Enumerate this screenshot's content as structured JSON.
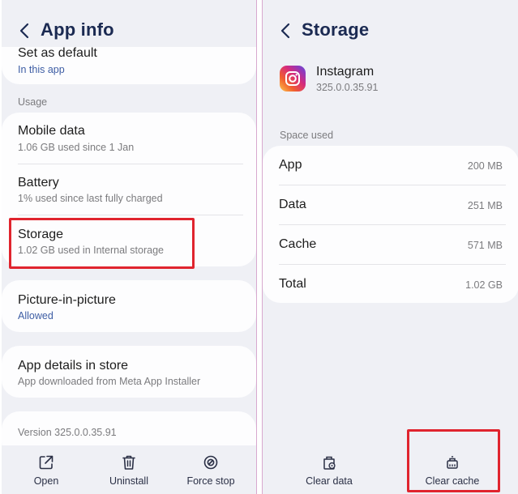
{
  "left": {
    "title": "App info",
    "set_default": {
      "title": "Set as default",
      "sub": "In this app"
    },
    "usage_label": "Usage",
    "mobile_data": {
      "title": "Mobile data",
      "sub": "1.06 GB used since 1 Jan"
    },
    "battery": {
      "title": "Battery",
      "sub": "1% used since last fully charged"
    },
    "storage": {
      "title": "Storage",
      "sub": "1.02 GB used in Internal storage"
    },
    "pip": {
      "title": "Picture-in-picture",
      "sub": "Allowed"
    },
    "details": {
      "title": "App details in store",
      "sub": "App downloaded from Meta App Installer"
    },
    "version": "Version 325.0.0.35.91",
    "buttons": {
      "open": "Open",
      "uninstall": "Uninstall",
      "force_stop": "Force stop"
    }
  },
  "right": {
    "title": "Storage",
    "app_name": "Instagram",
    "app_version": "325.0.0.35.91",
    "space_used_label": "Space used",
    "rows": [
      {
        "label": "App",
        "value": "200 MB"
      },
      {
        "label": "Data",
        "value": "251 MB"
      },
      {
        "label": "Cache",
        "value": "571 MB"
      },
      {
        "label": "Total",
        "value": "1.02 GB"
      }
    ],
    "buttons": {
      "clear_data": "Clear data",
      "clear_cache": "Clear cache"
    }
  },
  "colors": {
    "highlight": "#e0242e",
    "title": "#1b2a52",
    "link": "#3d5da4"
  }
}
